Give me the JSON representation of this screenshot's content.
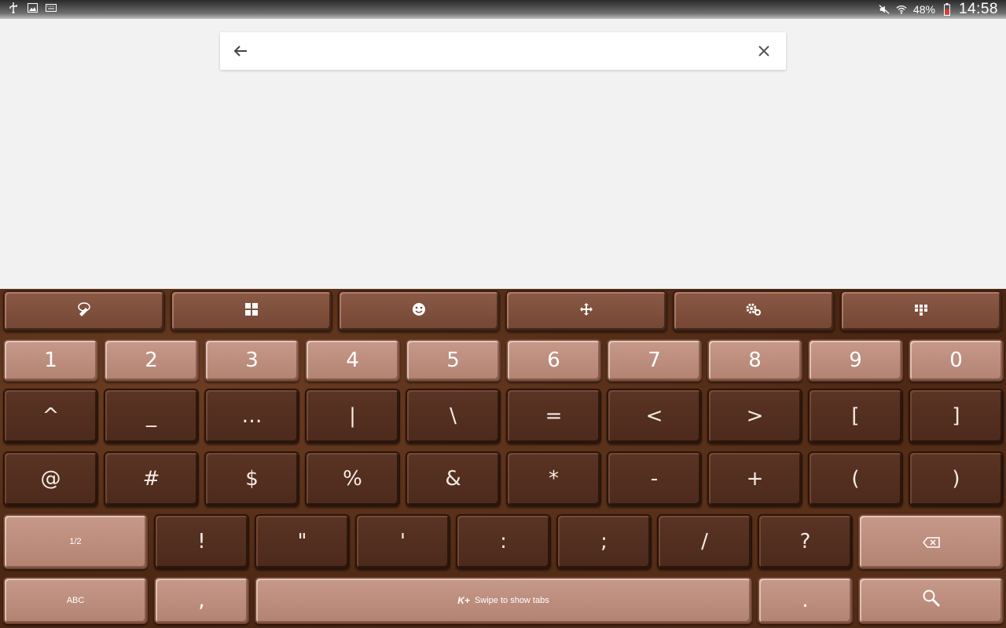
{
  "status_bar": {
    "left_icons": [
      "usb-icon",
      "image-icon",
      "keyboard-icon"
    ],
    "battery_percent": "48%",
    "time": "14:58",
    "right_icons": [
      "mute-icon",
      "wifi-icon",
      "battery-icon"
    ]
  },
  "search": {
    "value": "",
    "back_icon": "arrow-left-icon",
    "clear_icon": "close-icon"
  },
  "keyboard": {
    "toolbar": [
      "theme-icon",
      "numpad-icon",
      "emoji-icon",
      "move-icon",
      "settings-icon",
      "apps-grid-icon"
    ],
    "row_numbers": [
      "1",
      "2",
      "3",
      "4",
      "5",
      "6",
      "7",
      "8",
      "9",
      "0"
    ],
    "row_symbols1": [
      "^",
      "_",
      "…",
      "|",
      "\\",
      "=",
      "<",
      ">",
      "[",
      "]"
    ],
    "row_symbols2": [
      "@",
      "#",
      "$",
      "%",
      "&",
      "*",
      "-",
      "+",
      "(",
      ")"
    ],
    "row_symbols3": {
      "page_label": "1/2",
      "keys": [
        "!",
        "\"",
        "'",
        ":",
        ";",
        "/",
        "?"
      ],
      "delete_icon": "backspace-icon"
    },
    "row_bottom": {
      "abc_label": "ABC",
      "comma": ",",
      "space_label": "Swipe to show tabs",
      "space_badge": "K+",
      "period": ".",
      "search_icon": "search-icon"
    }
  },
  "colors": {
    "chocolate_dark": "#4c2a1c",
    "chocolate_light": "#b38372",
    "background": "#f2f2f2"
  }
}
